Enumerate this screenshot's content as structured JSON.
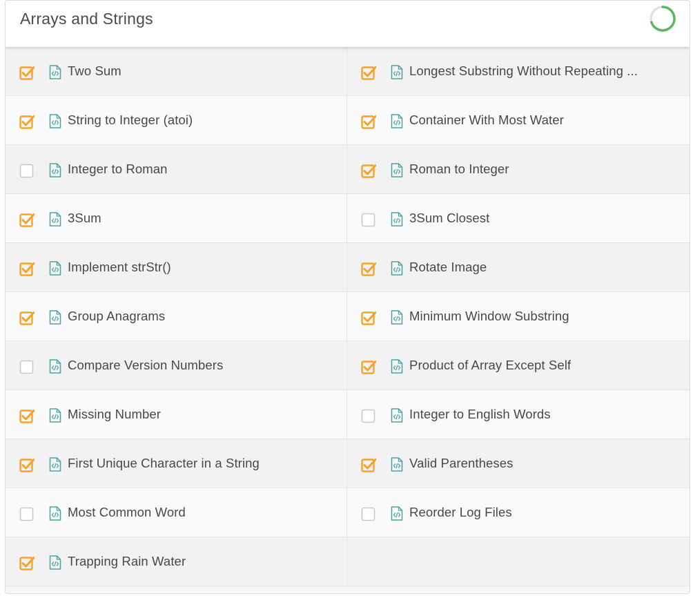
{
  "section": {
    "title": "Arrays and Strings",
    "progress_fraction": 0.7,
    "progress_color": "#5cb85c",
    "progress_track_color": "#e3e3e3"
  },
  "colors": {
    "check_orange": "#f6a22b",
    "file_icon_teal": "#4aa3a3",
    "empty_box_border": "#c8c8c8"
  },
  "problems": [
    {
      "title": "Two Sum",
      "completed": true,
      "icon": "code-file-icon"
    },
    {
      "title": "Longest Substring Without Repeating ...",
      "completed": true,
      "icon": "code-file-icon"
    },
    {
      "title": "String to Integer (atoi)",
      "completed": true,
      "icon": "code-file-icon"
    },
    {
      "title": "Container With Most Water",
      "completed": true,
      "icon": "code-file-icon"
    },
    {
      "title": "Integer to Roman",
      "completed": false,
      "icon": "code-file-icon"
    },
    {
      "title": "Roman to Integer",
      "completed": true,
      "icon": "code-file-icon"
    },
    {
      "title": "3Sum",
      "completed": true,
      "icon": "code-file-icon"
    },
    {
      "title": "3Sum Closest",
      "completed": false,
      "icon": "code-file-icon"
    },
    {
      "title": "Implement strStr()",
      "completed": true,
      "icon": "code-file-icon"
    },
    {
      "title": "Rotate Image",
      "completed": true,
      "icon": "code-file-icon"
    },
    {
      "title": "Group Anagrams",
      "completed": true,
      "icon": "code-file-icon"
    },
    {
      "title": "Minimum Window Substring",
      "completed": true,
      "icon": "code-file-icon"
    },
    {
      "title": "Compare Version Numbers",
      "completed": false,
      "icon": "code-file-icon"
    },
    {
      "title": "Product of Array Except Self",
      "completed": true,
      "icon": "code-file-icon"
    },
    {
      "title": "Missing Number",
      "completed": true,
      "icon": "code-file-icon"
    },
    {
      "title": "Integer to English Words",
      "completed": false,
      "icon": "code-file-icon"
    },
    {
      "title": "First Unique Character in a String",
      "completed": true,
      "icon": "code-file-icon"
    },
    {
      "title": "Valid Parentheses",
      "completed": true,
      "icon": "code-file-icon"
    },
    {
      "title": "Most Common Word",
      "completed": false,
      "icon": "code-file-icon"
    },
    {
      "title": "Reorder Log Files",
      "completed": false,
      "icon": "code-file-icon"
    },
    {
      "title": "Trapping Rain Water",
      "completed": true,
      "icon": "code-file-icon"
    }
  ]
}
